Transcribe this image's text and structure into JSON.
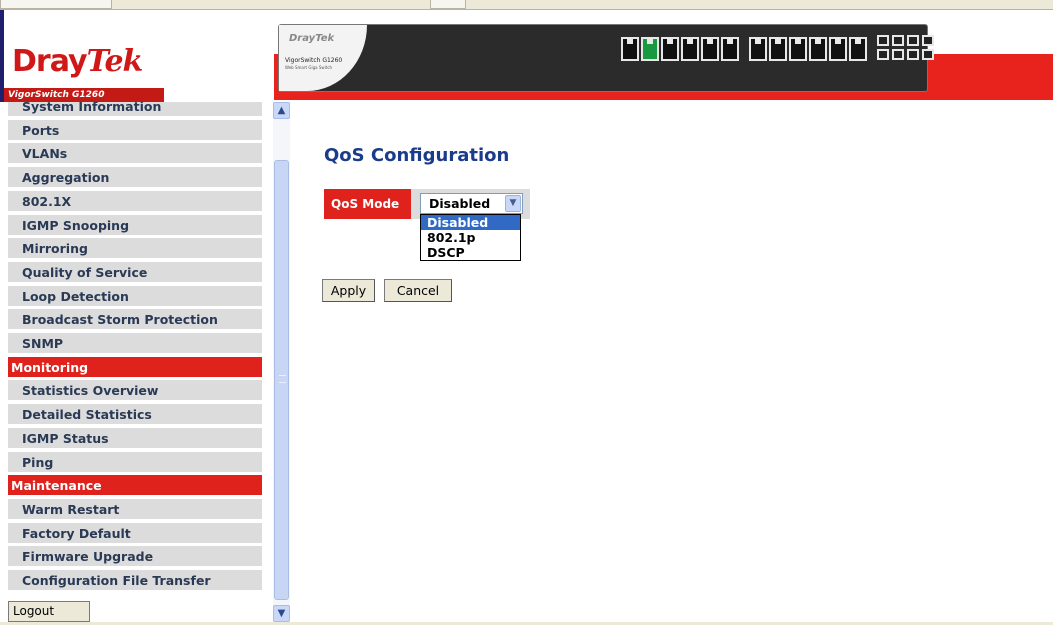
{
  "header": {
    "brand_main": "Dray",
    "brand_tek": "Tek",
    "model_label": "VigorSwitch G1260",
    "panel_brand": "DrayTek",
    "panel_model": "VigorSwitch G1260",
    "panel_sub": "Web Smart Giga Switch"
  },
  "sidebar": {
    "items": [
      {
        "label": "System Information",
        "section": false
      },
      {
        "label": "Ports",
        "section": false
      },
      {
        "label": "VLANs",
        "section": false
      },
      {
        "label": "Aggregation",
        "section": false
      },
      {
        "label": "802.1X",
        "section": false
      },
      {
        "label": "IGMP Snooping",
        "section": false
      },
      {
        "label": "Mirroring",
        "section": false
      },
      {
        "label": "Quality of Service",
        "section": false
      },
      {
        "label": "Loop Detection",
        "section": false
      },
      {
        "label": "Broadcast Storm Protection",
        "section": false
      },
      {
        "label": "SNMP",
        "section": false
      },
      {
        "label": "Monitoring",
        "section": true
      },
      {
        "label": "Statistics Overview",
        "section": false
      },
      {
        "label": "Detailed Statistics",
        "section": false
      },
      {
        "label": "IGMP Status",
        "section": false
      },
      {
        "label": "Ping",
        "section": false
      },
      {
        "label": "Maintenance",
        "section": true
      },
      {
        "label": "Warm Restart",
        "section": false
      },
      {
        "label": "Factory Default",
        "section": false
      },
      {
        "label": "Firmware Upgrade",
        "section": false
      },
      {
        "label": "Configuration File Transfer",
        "section": false
      }
    ],
    "logout_label": "Logout"
  },
  "main": {
    "title": "QoS Configuration",
    "qos_mode_label": "QoS Mode",
    "qos_mode_value": "Disabled",
    "qos_mode_options": [
      "Disabled",
      "802.1p",
      "DSCP"
    ],
    "apply_label": "Apply",
    "cancel_label": "Cancel"
  },
  "colors": {
    "accent_red": "#e0221d",
    "title_blue": "#1a3c8a",
    "menu_bg": "#dcdcdc",
    "select_highlight": "#316ac5"
  }
}
